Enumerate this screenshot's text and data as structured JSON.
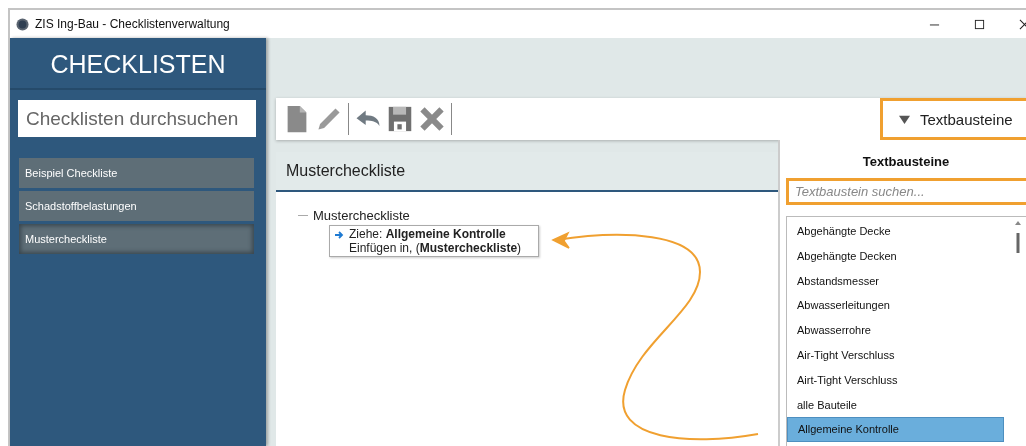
{
  "window": {
    "title": "ZIS Ing-Bau - Checklistenverwaltung"
  },
  "sidebar": {
    "title": "CHECKLISTEN",
    "search": {
      "placeholder": "Checklisten durchsuchen"
    },
    "items": [
      {
        "label": "Beispiel Checkliste",
        "selected": false
      },
      {
        "label": "Schadstoffbelastungen",
        "selected": false
      },
      {
        "label": "Mustercheckliste",
        "selected": true
      }
    ]
  },
  "toolbar": {
    "textbausteine_button": {
      "label": "Textbausteine",
      "expanded": true
    }
  },
  "panel": {
    "title": "Mustercheckliste",
    "tree": [
      {
        "label": "Mustercheckliste"
      }
    ],
    "drag_tooltip": {
      "lines": [
        "Ziehe: **Allgemeine Kontrolle**",
        "Einfügen in, (**Mustercheckliste**)"
      ]
    }
  },
  "textbausteine": {
    "title": "Textbausteine",
    "search": {
      "placeholder": "Textbaustein suchen..."
    },
    "items": [
      {
        "label": "Abgehängte Decke",
        "selected": false
      },
      {
        "label": "Abgehängte Decken",
        "selected": false
      },
      {
        "label": "Abstandsmesser",
        "selected": false
      },
      {
        "label": "Abwasserleitungen",
        "selected": false
      },
      {
        "label": "Abwasserrohre",
        "selected": false
      },
      {
        "label": "Air-Tight Verschluss",
        "selected": false
      },
      {
        "label": "Airt-Tight Verschluss",
        "selected": false
      },
      {
        "label": "alle Bauteile",
        "selected": false
      },
      {
        "label": "Allgemeine Kontrolle",
        "selected": true
      }
    ]
  }
}
